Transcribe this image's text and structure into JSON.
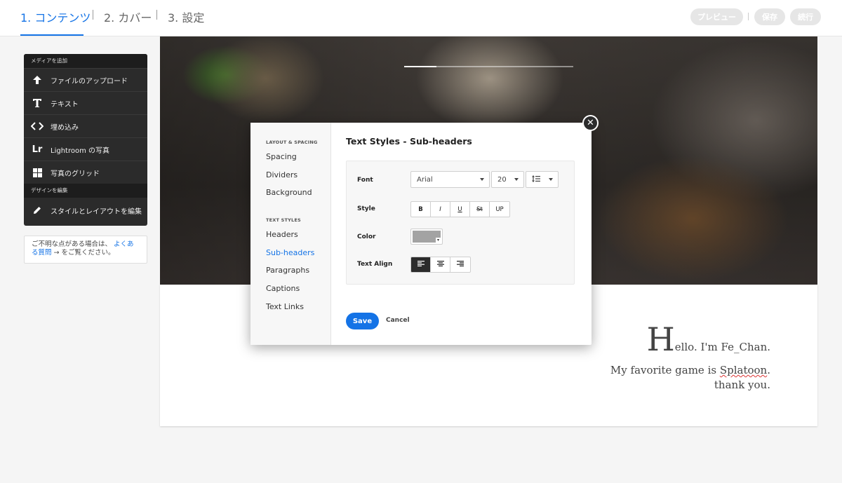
{
  "header": {
    "steps": [
      {
        "label": "1. コンテンツ",
        "active": true
      },
      {
        "label": "2. カバー",
        "active": false
      },
      {
        "label": "3. 設定",
        "active": false
      }
    ],
    "preview_label": "プレビュー",
    "save_label": "保存",
    "publish_label": "続行"
  },
  "sidebar": {
    "media_section": "メディアを追加",
    "items": [
      {
        "label": "ファイルのアップロード",
        "icon": "upload-arrow-icon"
      },
      {
        "label": "テキスト",
        "icon": "text-t-icon"
      },
      {
        "label": "埋め込み",
        "icon": "code-embed-icon"
      },
      {
        "label": "Lightroom の写真",
        "icon": "lightroom-icon",
        "glyph": "Lr"
      },
      {
        "label": "写真のグリッド",
        "icon": "grid-icon"
      }
    ],
    "design_section": "デザインを編集",
    "design_item": {
      "label": "スタイルとレイアウトを編集",
      "icon": "pencil-icon"
    },
    "help": {
      "prefix": "ご不明な点がある場合は、",
      "link": "よくある質問",
      "suffix": "→ をご覧ください。"
    }
  },
  "canvas": {
    "slideshow_progress": 0.19,
    "text": {
      "line1_cap": "H",
      "line1_rest": "ello. I'm Fe_Chan.",
      "line2_pre": "My favorite game is ",
      "line2_word": "Splatoon",
      "line2_post": ".",
      "line3": "thank you."
    }
  },
  "modal": {
    "title": "Text Styles - Sub-headers",
    "nav": {
      "layout_heading": "LAYOUT & SPACING",
      "layout_items": [
        "Spacing",
        "Dividers",
        "Background"
      ],
      "text_heading": "TEXT STYLES",
      "text_items": [
        "Headers",
        "Sub-headers",
        "Paragraphs",
        "Captions",
        "Text Links"
      ],
      "active": "Sub-headers"
    },
    "props": {
      "font_label": "Font",
      "font_value": "Arial",
      "size_value": "20",
      "line_height_icon": "line-height-icon",
      "style_label": "Style",
      "style_buttons": [
        "B",
        "I",
        "U",
        "St",
        "UP"
      ],
      "color_label": "Color",
      "color_value": "#a3a3a3",
      "align_label": "Text Align",
      "align_options": [
        "left",
        "center",
        "right"
      ],
      "align_selected": "left"
    },
    "save_label": "Save",
    "cancel_label": "Cancel",
    "close_glyph": "✕"
  }
}
